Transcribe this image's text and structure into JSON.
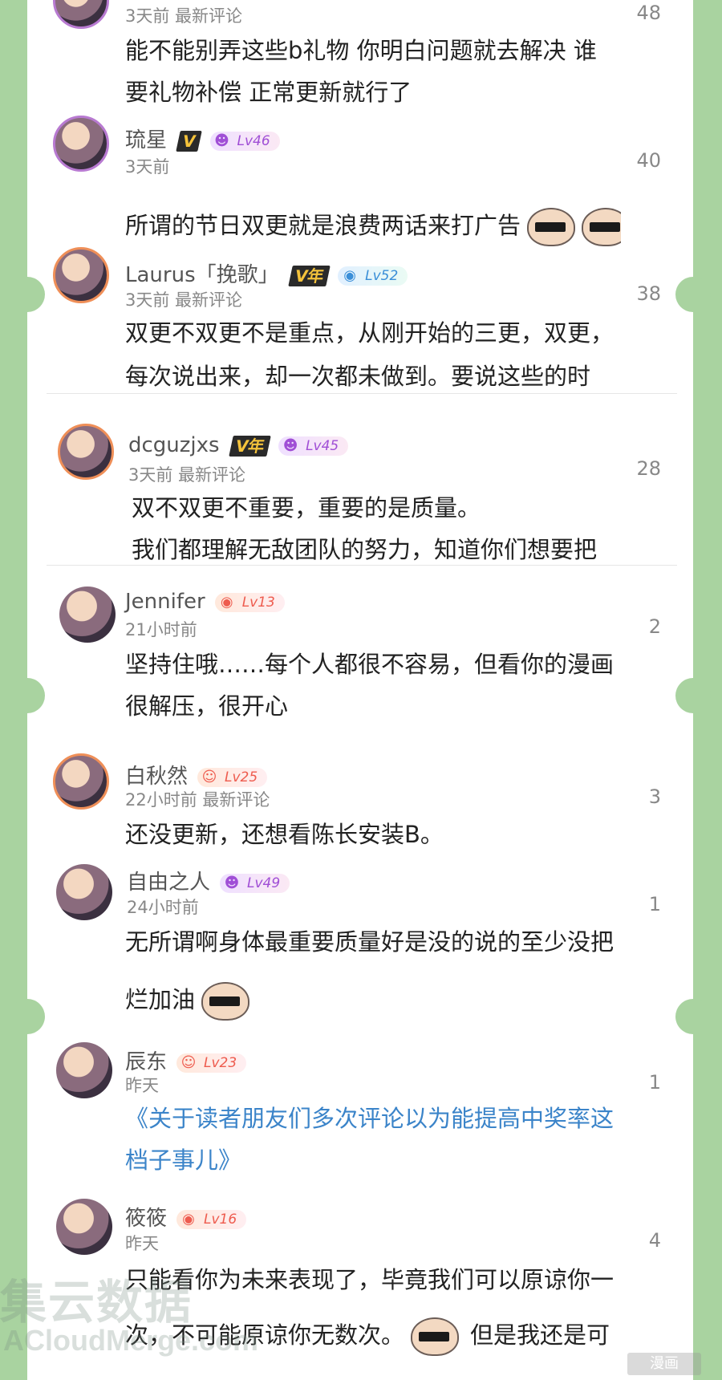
{
  "comments": [
    {
      "user": "",
      "meta": "3天前 最新评论",
      "count": "48",
      "lines": [
        "能不能别弄这些b礼物 你明白问题就去解决 谁",
        "要礼物补偿 正常更新就行了"
      ]
    },
    {
      "user": "琉星",
      "vip": "V",
      "level": "Lv46",
      "meta": "3天前",
      "count": "40",
      "lines": [
        "所谓的节日双更就是浪费两话来打广告"
      ]
    },
    {
      "user": "Laurus「挽歌」",
      "vip": "V年",
      "level": "Lv52",
      "meta": "3天前 最新评论",
      "count": "38",
      "lines": [
        "双更不双更不是重点，从刚开始的三更，双更，",
        "每次说出来，却一次都未做到。要说这些的时"
      ]
    },
    {
      "user": "dcguzjxs",
      "vip": "V年",
      "level": "Lv45",
      "meta": "3天前 最新评论",
      "count": "28",
      "lines": [
        "双不双更不重要，重要的是质量。",
        "我们都理解无敌团队的努力，知道你们想要把"
      ]
    },
    {
      "user": "Jennifer",
      "level": "Lv13",
      "meta": "21小时前",
      "count": "2",
      "lines": [
        "坚持住哦……每个人都很不容易，但看你的漫画",
        "很解压，很开心"
      ]
    },
    {
      "user": "白秋然",
      "level": "Lv25",
      "meta": "22小时前 最新评论",
      "count": "3",
      "lines": [
        "还没更新，还想看陈长安装B。"
      ]
    },
    {
      "user": "自由之人",
      "level": "Lv49",
      "meta": "24小时前",
      "count": "1",
      "lines": [
        "无所谓啊身体最重要质量好是没的说的至少没把",
        "烂加油"
      ]
    },
    {
      "user": "辰东",
      "level": "Lv23",
      "meta": "昨天",
      "count": "1",
      "lines": [
        "《关于读者朋友们多次评论以为能提高中奖率这",
        "档子事儿》"
      ]
    },
    {
      "user": "筱筱",
      "level": "Lv16",
      "meta": "昨天",
      "count": "4",
      "lines": [
        "只能看你为未来表现了，毕竟我们可以原谅你一",
        "次，不可能原谅你无数次。",
        "但是我还是可"
      ]
    }
  ],
  "watermark": {
    "cn": "集云数据",
    "en": "ACloudMerge.com",
    "corner": "漫画"
  },
  "colors": {
    "background": "#a9d3a0",
    "panel": "#ffffff",
    "link": "#3b84c9"
  }
}
